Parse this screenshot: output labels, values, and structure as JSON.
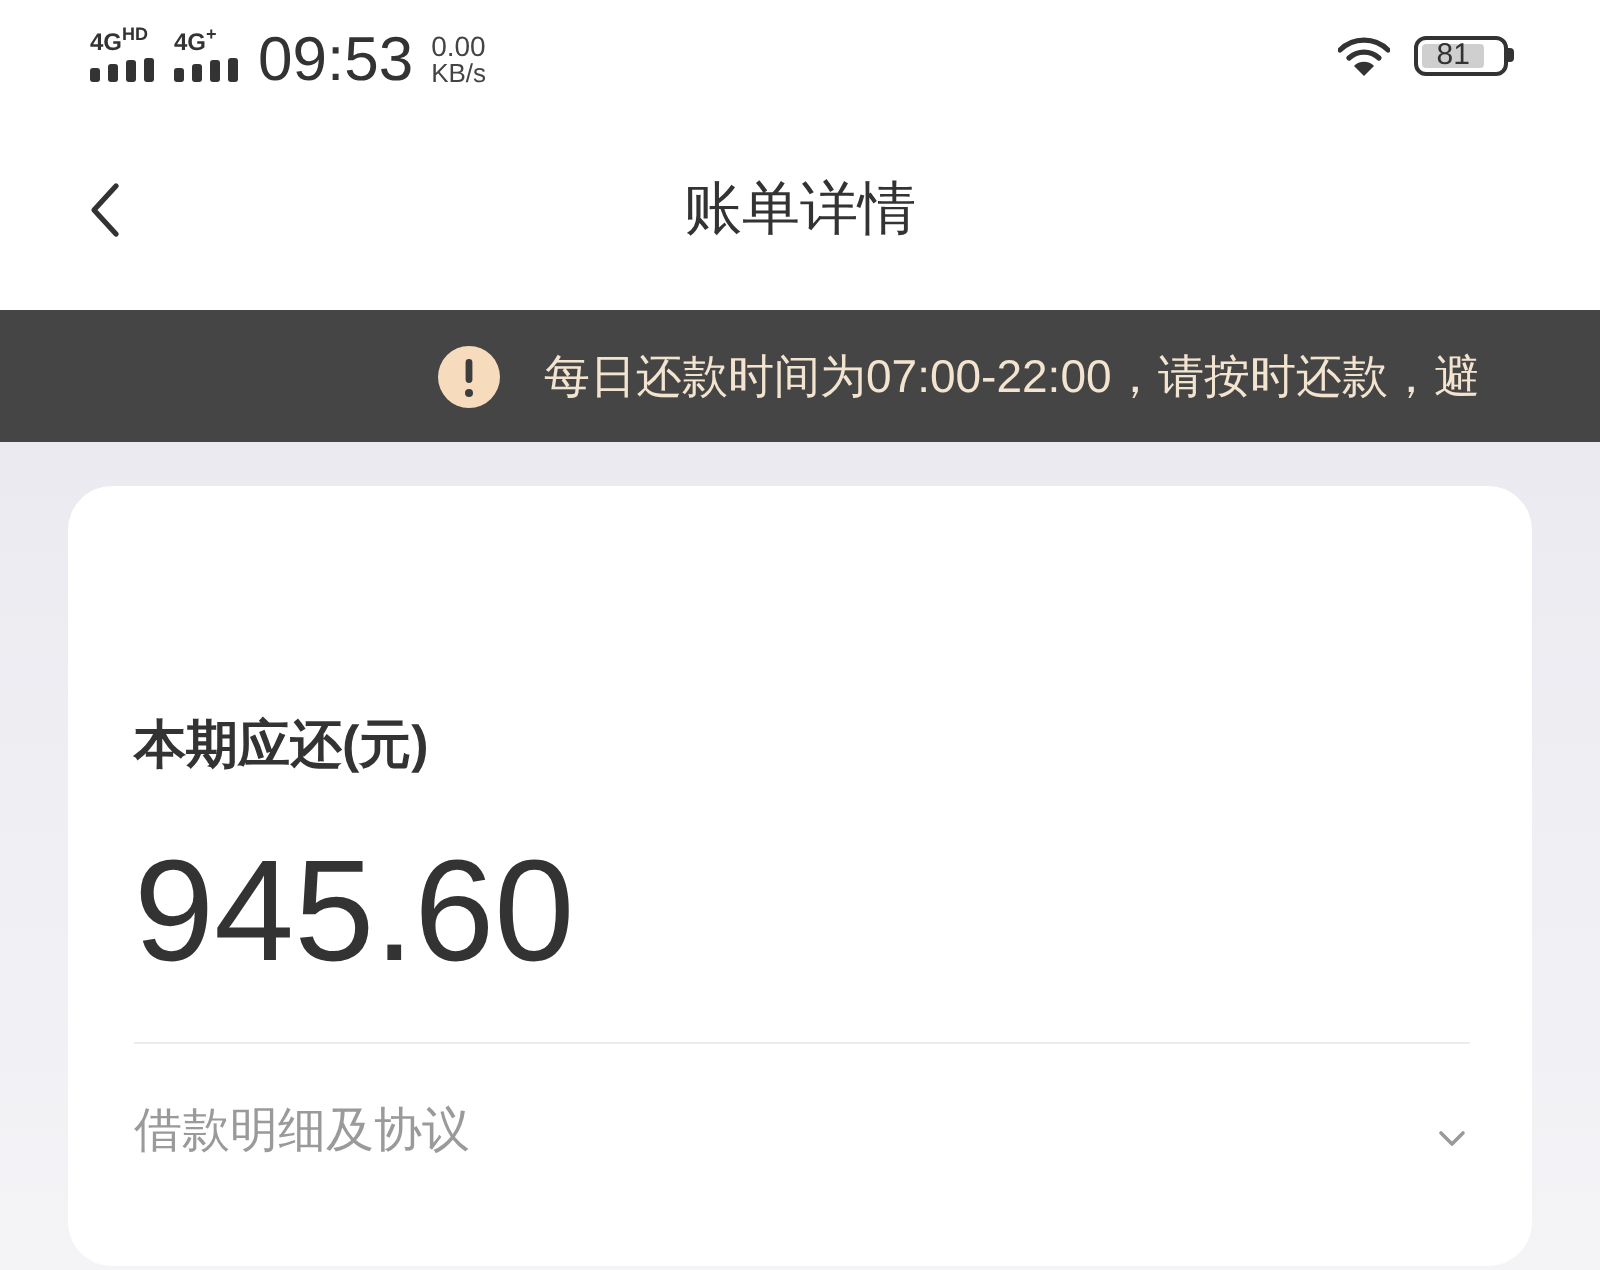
{
  "status_bar": {
    "networks": [
      {
        "label": "4G$^{HD}$"
      },
      {
        "label": "4G$^{+}$"
      }
    ],
    "time": "09:53",
    "speed_value": "0.00",
    "speed_unit": "KB/s",
    "battery": "81"
  },
  "nav_bar": {
    "title": "账单详情"
  },
  "notice": {
    "text": "每日还款时间为07:00-22:00，请按时还款，避"
  },
  "bill_card": {
    "label": "本期应还(元)",
    "amount": "945.60",
    "details_link": "借款明细及协议"
  }
}
